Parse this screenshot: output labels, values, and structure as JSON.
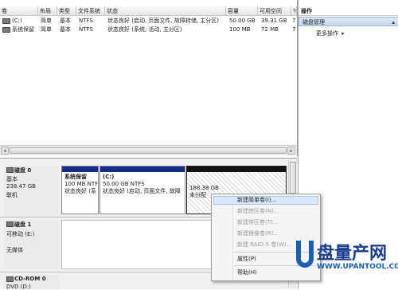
{
  "volume_table": {
    "headers": [
      "卷",
      "布局",
      "类型",
      "文件系统",
      "状态",
      "容量",
      "可用空间",
      "%"
    ],
    "rows": [
      {
        "volume": "(C:)",
        "layout": "简单",
        "type": "基本",
        "fs": "NTFS",
        "status": "状态良好 (启动, 页面文件, 故障转储, 主分区)",
        "capacity": "50.00 GB",
        "free": "39.31 GB",
        "pct": "7"
      },
      {
        "volume": "系统保留",
        "layout": "简单",
        "type": "基本",
        "fs": "NTFS",
        "status": "状态良好 (系统, 活动, 主分区)",
        "capacity": "100 MB",
        "free": "72 MB",
        "pct": "7"
      }
    ]
  },
  "scroll": {
    "left": "◂",
    "right": "▸",
    "up": "▴",
    "down": "▾"
  },
  "disks": [
    {
      "name": "磁盘 0",
      "type": "基本",
      "size": "238.47 GB",
      "status": "联机",
      "partitions": [
        {
          "name": "系统保留",
          "line2": "100 MB NTFS",
          "line3": "状态良好 (系"
        },
        {
          "name": "(C:)",
          "line2": "50.00 GB NTFS",
          "line3": "状态良好 (启动, 页面文件, 故障"
        },
        {
          "name": "188.38 GB",
          "line2": "未分配"
        }
      ]
    },
    {
      "name": "磁盘 1",
      "type": "可移动 (E:)",
      "status": "无媒体"
    },
    {
      "name": "CD-ROM 0",
      "type": "DVD (D:)"
    }
  ],
  "actions": {
    "header": "操作",
    "selected": "磁盘管理",
    "more": "更多操作"
  },
  "context_menu": {
    "items": [
      {
        "label": "新建简单卷(I)...",
        "enabled": true
      },
      {
        "label": "新建跨区卷(N)...",
        "enabled": false
      },
      {
        "label": "新建带区卷(T)...",
        "enabled": false
      },
      {
        "label": "新建镜像卷(R)...",
        "enabled": false
      },
      {
        "label": "新建 RAID-5 卷(W)...",
        "enabled": false
      },
      {
        "label": "属性(P)",
        "enabled": true
      },
      {
        "label": "帮助(H)",
        "enabled": true
      }
    ]
  },
  "watermark": {
    "brand": "盘量产网",
    "url": "WWW.UPANTOOL.COM"
  },
  "colors": {
    "primary_partition": "#142d8a",
    "unallocated": "#111111",
    "selection": "#cfe0f6"
  }
}
